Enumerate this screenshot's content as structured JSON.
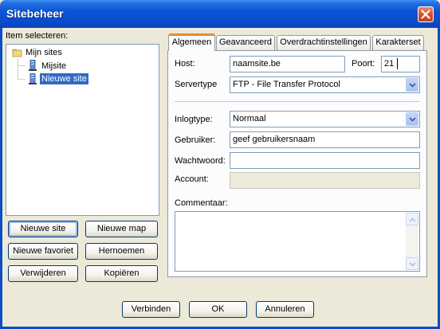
{
  "window": {
    "title": "Sitebeheer"
  },
  "left_panel": {
    "label": "Item selecteren:",
    "tree": {
      "root": "Mijn sites",
      "children": [
        {
          "label": "Mijsite",
          "selected": false
        },
        {
          "label": "Nieuwe site",
          "selected": true
        }
      ]
    },
    "buttons": {
      "new_site": "Nieuwe site",
      "new_folder": "Nieuwe map",
      "new_bookmark": "Nieuwe favoriet",
      "rename": "Hernoemen",
      "delete": "Verwijderen",
      "copy": "Kopiëren"
    }
  },
  "tabs": [
    "Algemeen",
    "Geavanceerd",
    "Overdrachtinstellingen",
    "Karakterset"
  ],
  "active_tab": "Algemeen",
  "general": {
    "host_label": "Host:",
    "host_value": "naamsite.be",
    "port_label": "Poort:",
    "port_value": "21",
    "servertype_label": "Servertype",
    "servertype_value": "FTP - File Transfer Protocol",
    "logintype_label": "Inlogtype:",
    "logintype_value": "Normaal",
    "user_label": "Gebruiker:",
    "user_value": "geef gebruikersnaam",
    "password_label": "Wachtwoord:",
    "password_value": "",
    "account_label": "Account:",
    "account_value": "",
    "comments_label": "Commentaar:",
    "comments_value": ""
  },
  "footer": {
    "connect": "Verbinden",
    "ok": "OK",
    "cancel": "Annuleren"
  },
  "colors": {
    "titlebar": "#0b55d6",
    "selection": "#316ac5",
    "active_tab_accent": "#e68b2c",
    "dialog_bg": "#ece9d8"
  }
}
